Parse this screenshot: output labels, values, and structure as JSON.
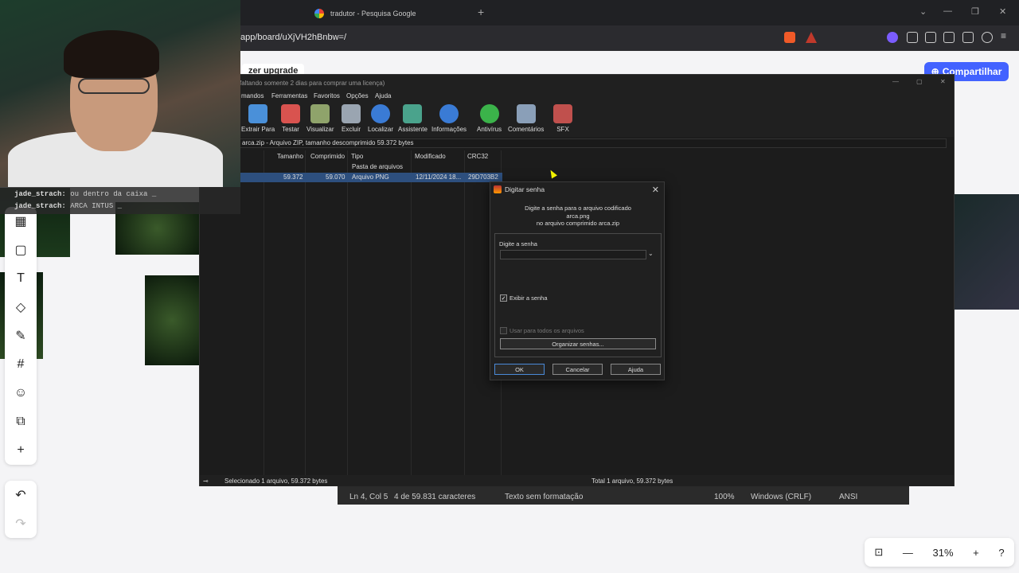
{
  "browser": {
    "tab_title": "tradutor - Pesquisa Google",
    "new_tab": "+",
    "url": "app/board/uXjVH2hBnbw=/"
  },
  "board": {
    "upgrade_label": "zer upgrade",
    "share_label": "Compartilhar",
    "zoom": "31%",
    "tools": [
      "templates-icon",
      "sticky-note-icon",
      "text-icon",
      "shapes-icon",
      "pen-icon",
      "frame-icon",
      "reaction-icon",
      "embed-icon",
      "add-icon"
    ]
  },
  "chat": [
    {
      "user": "jade_strach:",
      "msg": "ou dentro da caixa _"
    },
    {
      "user": "jade_strach:",
      "msg": "ARCA INTUS _"
    }
  ],
  "notepad_status": {
    "position": "Ln 4, Col 5",
    "count": "4 de 59.831 caracteres",
    "format": "Texto sem formatação",
    "zoom": "100%",
    "eol": "Windows (CRLF)",
    "encoding": "ANSI"
  },
  "winrar": {
    "title": "faltando somente 2 dias para comprar uma licença)",
    "menu": [
      "mandos",
      "Ferramentas",
      "Favoritos",
      "Opções",
      "Ajuda"
    ],
    "toolbar": [
      {
        "label": "Extrair Para",
        "icon": "extract-icon",
        "color": "#4a90d9"
      },
      {
        "label": "Testar",
        "icon": "test-icon",
        "color": "#d9534f"
      },
      {
        "label": "Visualizar",
        "icon": "view-icon",
        "color": "#8fa36b"
      },
      {
        "label": "Excluir",
        "icon": "delete-icon",
        "color": "#9aa5b1"
      },
      {
        "label": "Localizar",
        "icon": "find-icon",
        "color": "#3a7bd5"
      },
      {
        "label": "Assistente",
        "icon": "wizard-icon",
        "color": "#4aa38c"
      },
      {
        "label": "Informações",
        "icon": "info-icon",
        "color": "#3a7bd5"
      },
      {
        "label": "Antivírus",
        "icon": "antivirus-icon",
        "color": "#3bb34a"
      },
      {
        "label": "Comentários",
        "icon": "comments-icon",
        "color": "#8a9fb8"
      },
      {
        "label": "SFX",
        "icon": "sfx-icon",
        "color": "#c0504d"
      }
    ],
    "path": "arca.zip - Arquivo ZIP, tamanho descomprimido 59.372 bytes",
    "columns": [
      "Tamanho",
      "Comprimido",
      "Tipo",
      "Modificado",
      "CRC32"
    ],
    "rows": [
      {
        "size": "",
        "packed": "",
        "type": "Pasta de arquivos",
        "modified": "",
        "crc": ""
      },
      {
        "size": "59.372",
        "packed": "59.070",
        "type": "Arquivo PNG",
        "modified": "12/11/2024 18...",
        "crc": "29D703B2"
      }
    ],
    "status_left": "Selecionado 1 arquivo, 59.372 bytes",
    "status_right": "Total 1 arquivo, 59.372 bytes"
  },
  "dialog": {
    "title": "Digitar senha",
    "line1": "Digite a senha para o arquivo codificado",
    "line2": "arca.png",
    "line3": "no arquivo comprimido arca.zip",
    "field_label": "Digite a senha",
    "password_value": "",
    "show_password": "Exibir a senha",
    "use_for_all": "Usar para todos os arquivos",
    "organize": "Organizar senhas...",
    "ok": "OK",
    "cancel": "Cancelar",
    "help": "Ajuda"
  }
}
